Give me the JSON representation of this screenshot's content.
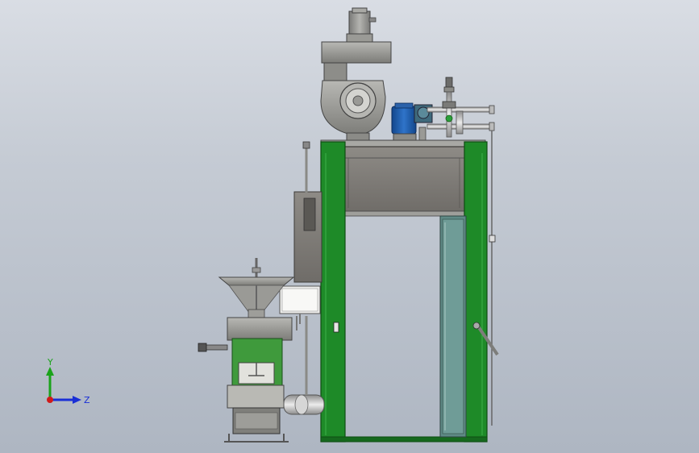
{
  "viewport": {
    "background_top": "#d9dde4",
    "background_bottom": "#aeb6c2"
  },
  "colors": {
    "frame_green": "#1e8a28",
    "panel_green": "#3f9a3c",
    "metal": "#9a9a96",
    "metal_dark": "#6e6e6c",
    "motor_blue": "#1f5fb0",
    "glass": "#5f8a86",
    "pipe": "#c9c9c9"
  },
  "triad": {
    "y_label": "Y",
    "z_label": "Z",
    "y_color": "#1aa31a",
    "z_color": "#1a2fd6",
    "x_color": "#d01a1a"
  },
  "icons": {
    "triad": "coordinate-triad-icon"
  }
}
